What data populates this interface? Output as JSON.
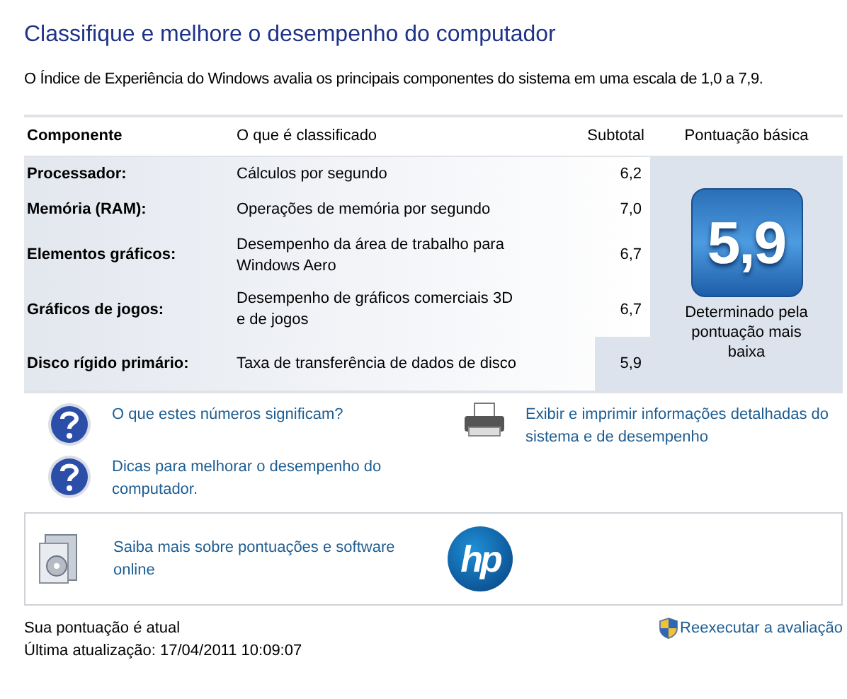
{
  "title": "Classifique e melhore o desempenho do computador",
  "description": "O Índice de Experiência do Windows avalia os principais componentes do sistema em uma escala de 1,0 a 7,9.",
  "table": {
    "columns": [
      "Componente",
      "O que é classificado",
      "Subtotal",
      "Pontuação básica"
    ],
    "rows": [
      {
        "component": "Processador:",
        "rated": "Cálculos por segundo",
        "subtotal": "6,2",
        "lowest": false
      },
      {
        "component": "Memória (RAM):",
        "rated": "Operações de memória por segundo",
        "subtotal": "7,0",
        "lowest": false
      },
      {
        "component": "Elementos gráficos:",
        "rated": "Desempenho da área de trabalho para Windows Aero",
        "subtotal": "6,7",
        "lowest": false
      },
      {
        "component": "Gráficos de jogos:",
        "rated": "Desempenho de gráficos comerciais 3D e de jogos",
        "subtotal": "6,7",
        "lowest": false
      },
      {
        "component": "Disco rígido primário:",
        "rated": "Taxa de transferência de dados de disco",
        "subtotal": "5,9",
        "lowest": true
      }
    ],
    "base_score": "5,9",
    "base_note": "Determinado pela pontuação mais baixa"
  },
  "links": [
    {
      "kind": "help",
      "label": "O que estes números significam?"
    },
    {
      "kind": "print",
      "label": "Exibir e imprimir informações detalhadas do sistema e de desempenho"
    },
    {
      "kind": "help",
      "label": "Dicas para melhorar o desempenho do computador."
    }
  ],
  "promo": {
    "label": "Saiba mais sobre pontuações e software online",
    "logo": "hp"
  },
  "status": "Sua pontuação é atual",
  "last_update": "Última atualização: 17/04/2011 10:09:07",
  "rerun": "Reexecutar a avaliação"
}
